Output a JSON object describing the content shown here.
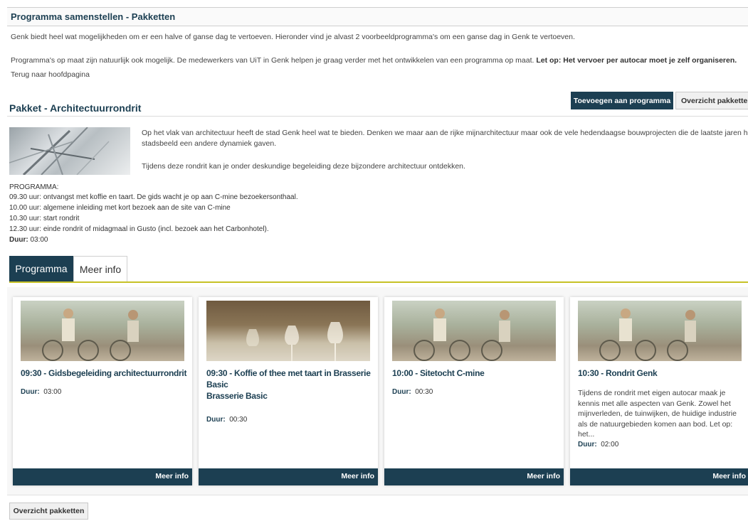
{
  "header": {
    "title": "Programma samenstellen - Pakketten"
  },
  "intro": {
    "line1": "Genk biedt heel wat mogelijkheden om er een halve of ganse dag te vertoeven. Hieronder vind je alvast 2 voorbeeldprogramma's om een ganse dag in Genk te vertoeven.",
    "line2": "Programma's op maat zijn natuurlijk ook mogelijk. De medewerkers van UiT in Genk helpen je graag verder met het ontwikkelen van een programma op maat.",
    "line2_bold": "Let op: Het vervoer per autocar moet je zelf organiseren.",
    "back_link": "Terug naar hoofdpagina"
  },
  "actions": {
    "add_label": "Toevoegen aan programma",
    "overview_label": "Overzicht pakketten"
  },
  "package": {
    "title": "Pakket - Architectuurrondrit",
    "desc1": "Op het vlak van architectuur heeft de stad Genk heel wat te bieden. Denken we maar aan de rijke mijnarchitectuur maar ook de vele hedendaagse bouwprojecten die de laatste jaren het",
    "desc2": "stadsbeeld een andere dynamiek gaven.",
    "desc3": "Tijdens deze rondrit kan je onder deskundige begeleiding deze bijzondere architectuur ontdekken."
  },
  "programma": {
    "heading": "PROGRAMMA:",
    "lines": [
      "09.30 uur: ontvangst met koffie en taart. De gids wacht je op aan C-mine bezoekersonthaal.",
      "10.00 uur: algemene inleiding met kort bezoek aan de site van C-mine",
      "10.30 uur: start rondrit",
      "12.30 uur: einde rondrit of midagmaal in Gusto (incl. bezoek aan het Carbonhotel)."
    ],
    "duur_label": "Duur:",
    "duur_value": "03:00"
  },
  "tabs": [
    {
      "label": "Programma",
      "active": true
    },
    {
      "label": "Meer info",
      "active": false
    }
  ],
  "cards": [
    {
      "image": "cyclists-photo",
      "title_l1": "09:30 - Gidsbegeleiding architectuurrondrit",
      "title_l2": "",
      "title_l3": "",
      "text": [],
      "duur_label": "Duur:",
      "duur_value": "03:00",
      "more": "Meer info"
    },
    {
      "image": "wine-glasses-photo",
      "title_l1": "09:30 - Koffie of thee met taart in Brasserie",
      "title_l2": "Basic",
      "title_l3": "Brasserie Basic",
      "text": [],
      "duur_label": "Duur:",
      "duur_value": "00:30",
      "more": "Meer info"
    },
    {
      "image": "cyclists-photo",
      "title_l1": "10:00 - Sitetocht C-mine",
      "title_l2": "",
      "title_l3": "",
      "text": [],
      "duur_label": "Duur:",
      "duur_value": "00:30",
      "more": "Meer info"
    },
    {
      "image": "cyclists-photo",
      "title_l1": "10:30 - Rondrit Genk",
      "title_l2": "",
      "title_l3": "",
      "text": [
        "Tijdens de rondrit met eigen autocar maak je",
        "kennis met alle aspecten van Genk. Zowel het",
        "mijnverleden, de tuinwijken, de huidige industrie",
        "als de natuurgebieden komen aan bod. Let op:",
        "het..."
      ],
      "duur_label": "Duur:",
      "duur_value": "02:00",
      "more": "Meer info"
    }
  ],
  "footer": {
    "overview_label": "Overzicht pakketten"
  },
  "colors": {
    "primary": "#1c3f52",
    "accent": "#c7c227"
  }
}
